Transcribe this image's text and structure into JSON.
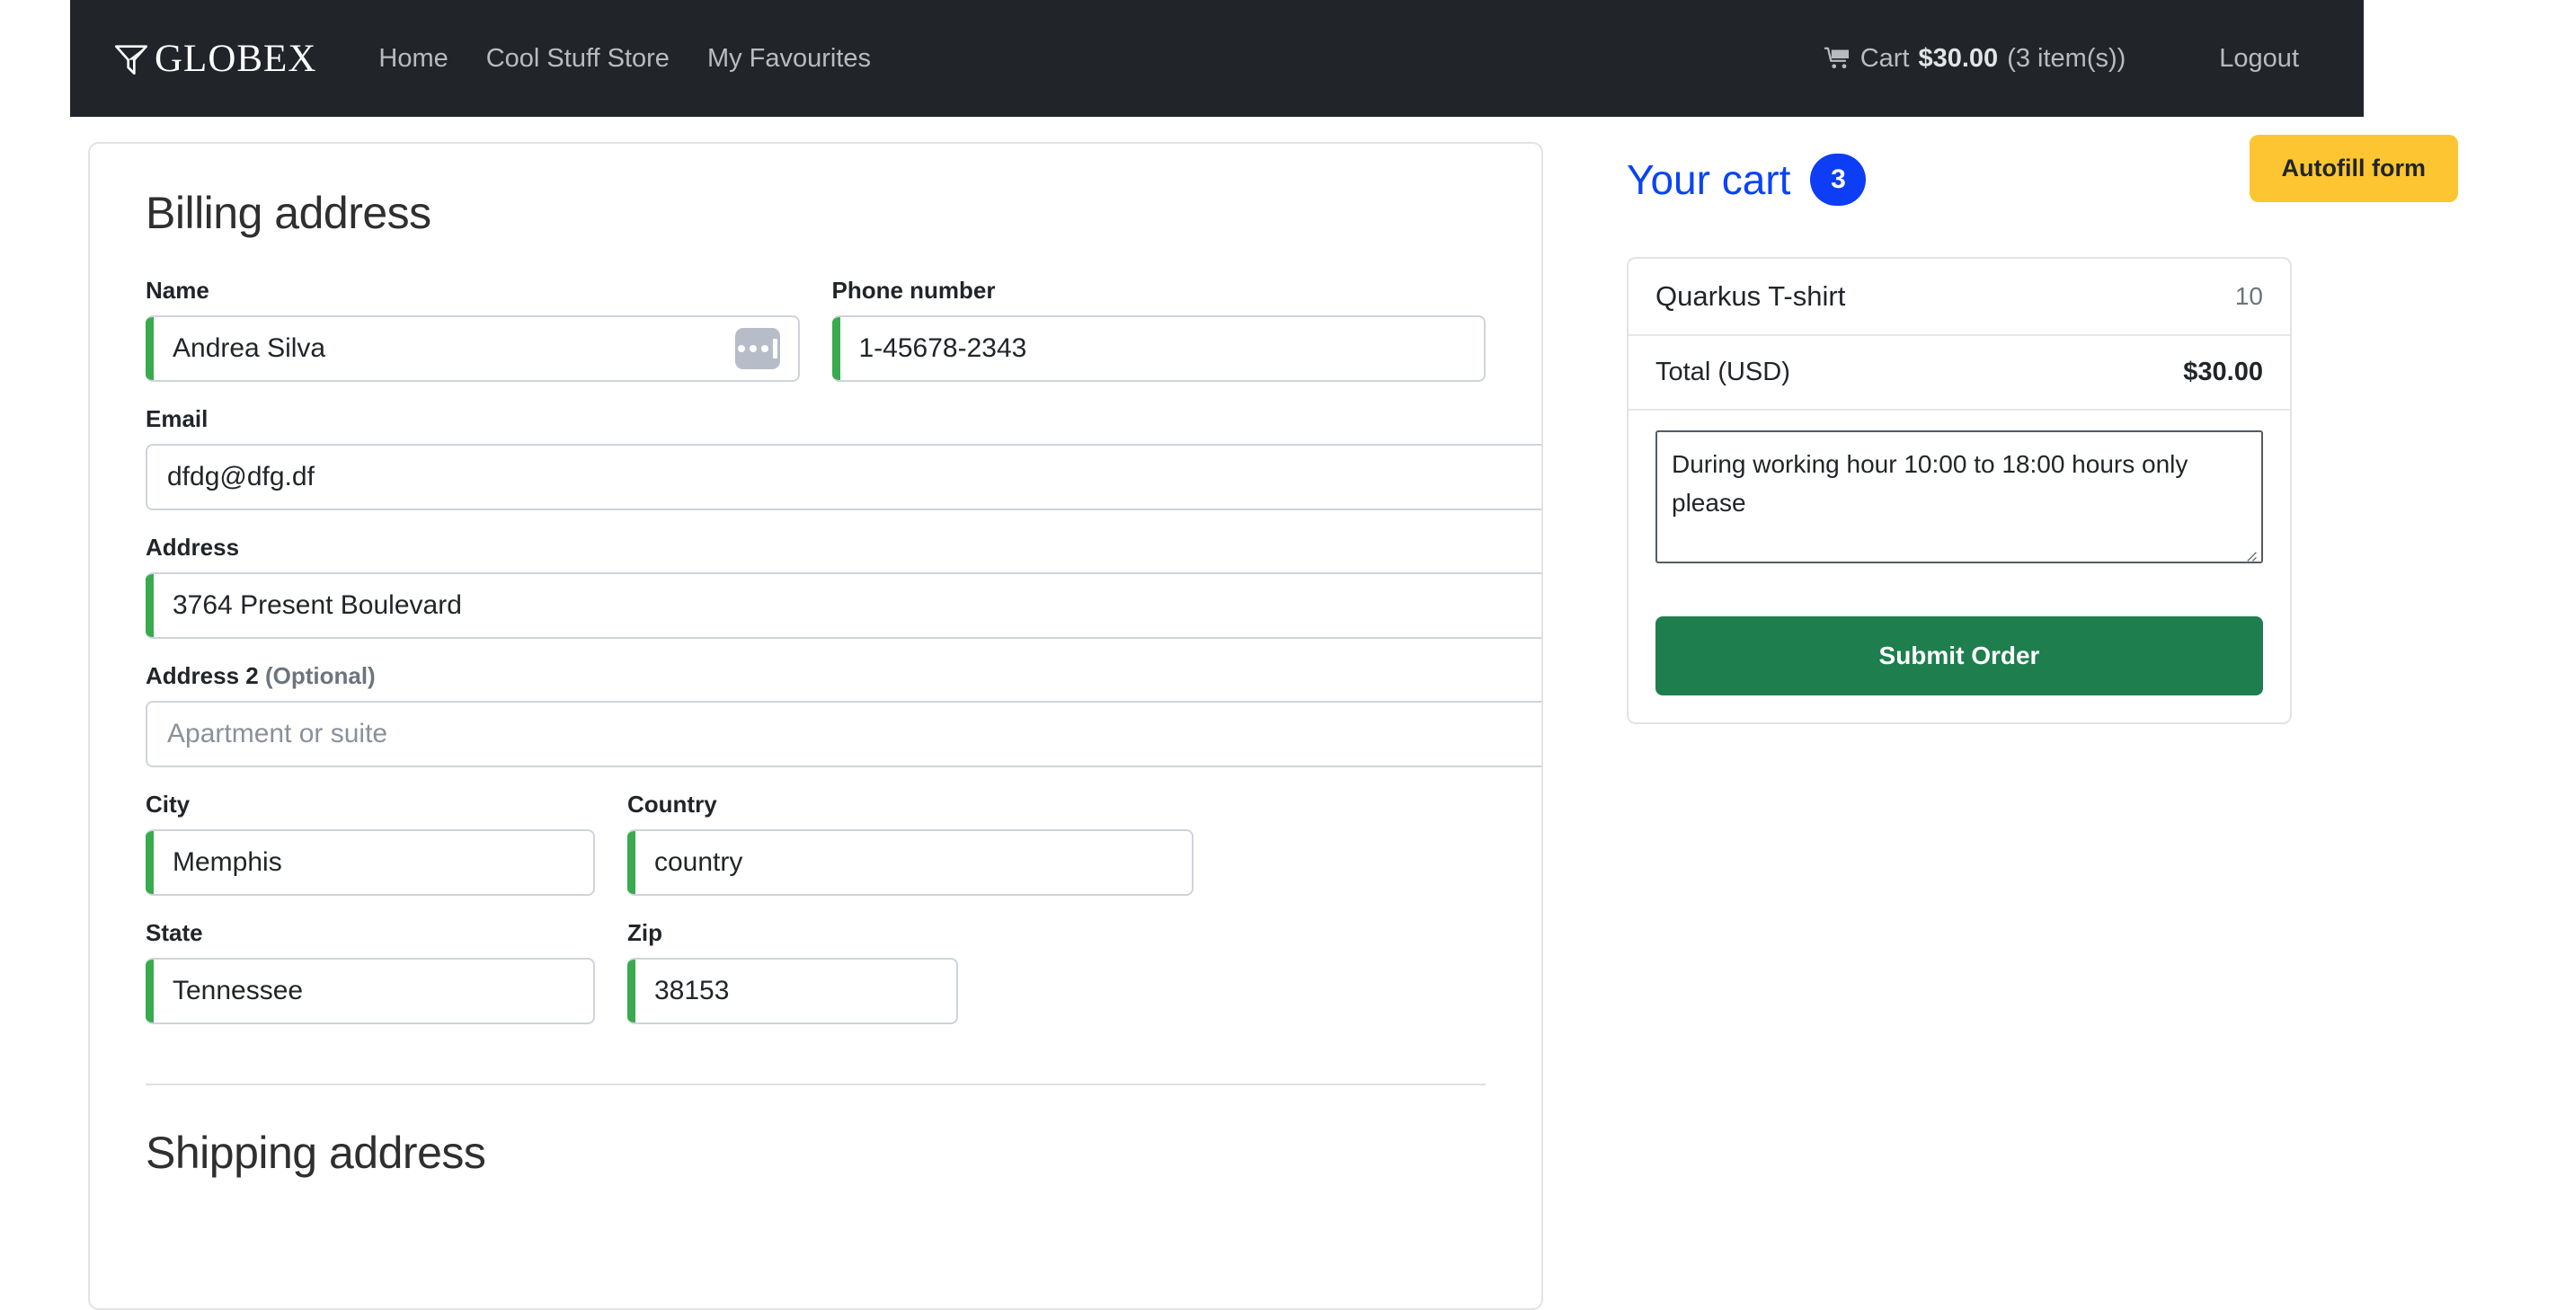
{
  "navbar": {
    "brand": "GLOBEX",
    "brand_icon": "funnel-logo-icon",
    "links": [
      {
        "label": "Home"
      },
      {
        "label": "Cool Stuff Store"
      },
      {
        "label": "My Favourites"
      }
    ],
    "cart": {
      "icon": "shopping-cart-icon",
      "label": "Cart",
      "price": "$30.00",
      "count": "(3 item(s))"
    },
    "logout": "Logout"
  },
  "billing": {
    "title": "Billing address",
    "name": {
      "label": "Name",
      "value": "Andrea Silva",
      "autofill_icon": "password-manager-dots-icon"
    },
    "phone": {
      "label": "Phone number",
      "value": "1-45678-2343"
    },
    "email": {
      "label": "Email",
      "value": "dfdg@dfg.df"
    },
    "address": {
      "label": "Address",
      "value": "3764 Present Boulevard"
    },
    "address2": {
      "label": "Address 2",
      "optional": "(Optional)",
      "value": "",
      "placeholder": "Apartment or suite"
    },
    "city": {
      "label": "City",
      "value": "Memphis"
    },
    "country": {
      "label": "Country",
      "value": "country"
    },
    "state": {
      "label": "State",
      "value": "Tennessee"
    },
    "zip": {
      "label": "Zip",
      "value": "38153"
    }
  },
  "shipping": {
    "title": "Shipping address"
  },
  "cart_panel": {
    "title": "Your cart",
    "badge": "3",
    "autofill_button": "Autofill form",
    "items": [
      {
        "name": "Quarkus T-shirt",
        "qty": "10"
      }
    ],
    "total_label": "Total (USD)",
    "total_value": "$30.00",
    "note": "During working hour 10:00 to 18:00 hours only please",
    "submit_button": "Submit Order"
  },
  "colors": {
    "navbar_bg": "#212529",
    "valid_green": "#3aaa4e",
    "accent_blue": "#0d3df5",
    "autofill_yellow": "#fdc531",
    "submit_green": "#1e7e4d"
  }
}
